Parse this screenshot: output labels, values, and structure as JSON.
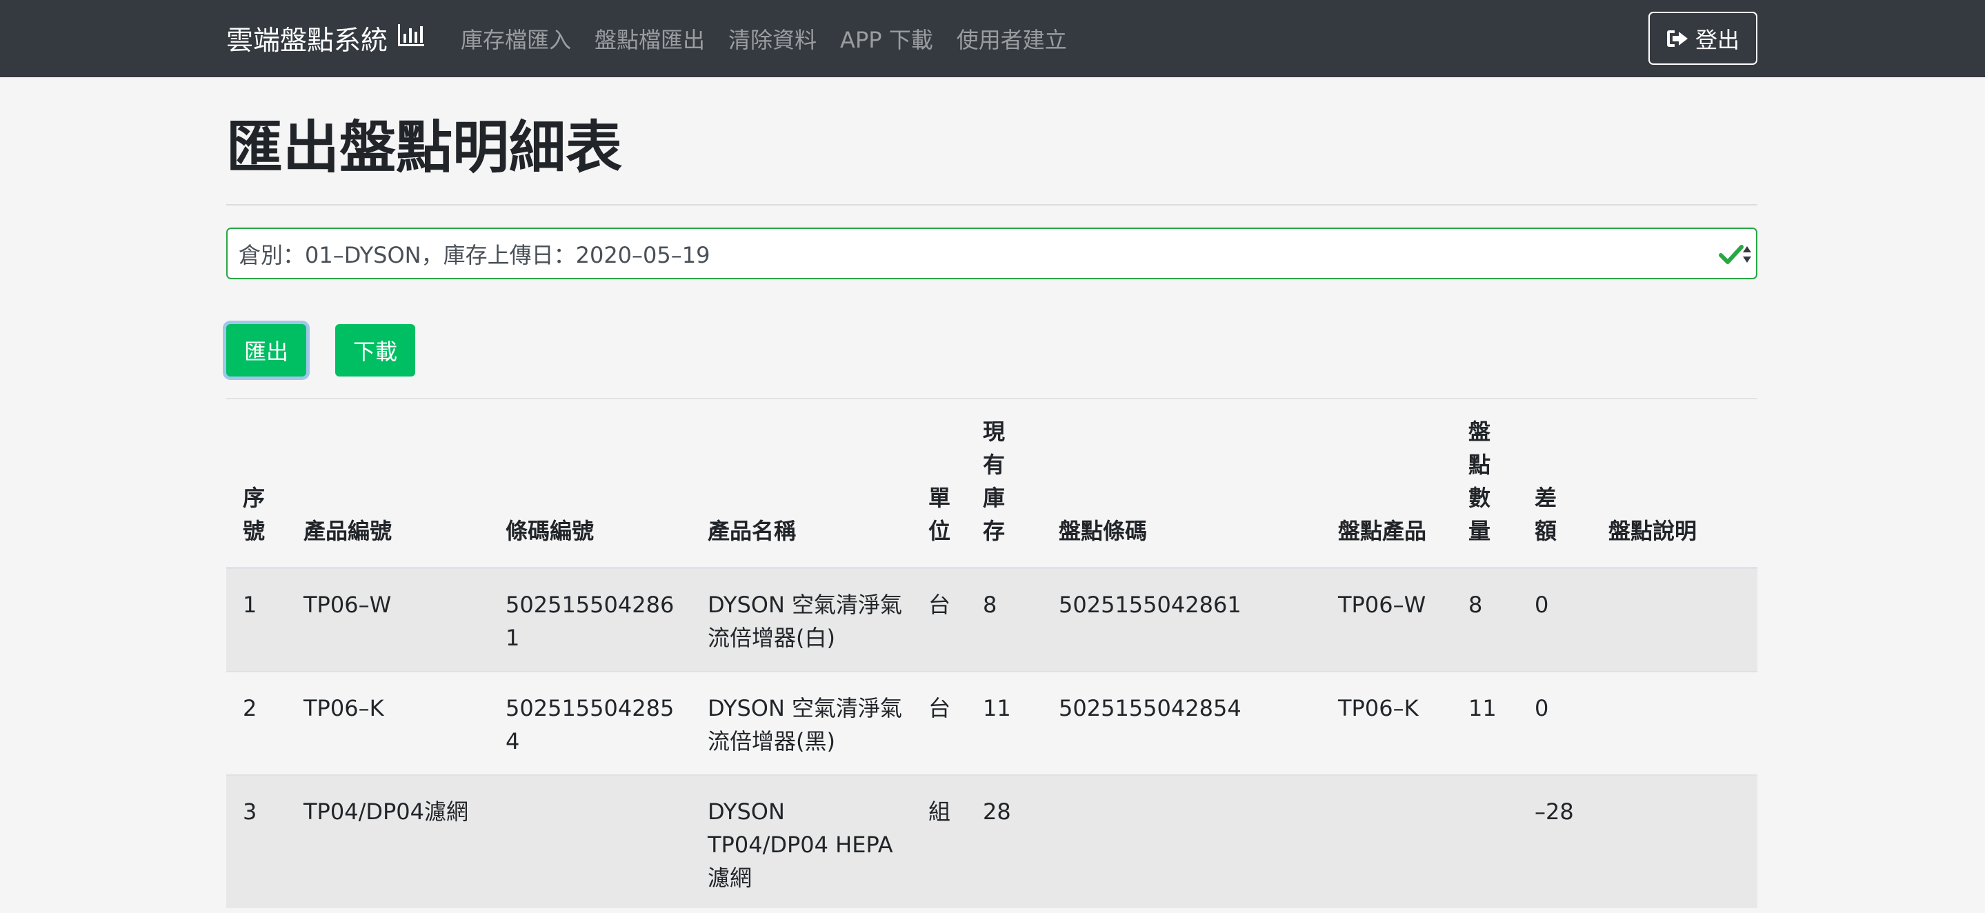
{
  "navbar": {
    "brand": "雲端盤點系統",
    "brand_icon": "bar-chart-icon",
    "links": [
      "庫存檔匯入",
      "盤點檔匯出",
      "清除資料",
      "APP 下載",
      "使用者建立"
    ],
    "logout_label": "登出",
    "logout_icon": "sign-out-icon"
  },
  "page": {
    "title": "匯出盤點明細表"
  },
  "warehouse_select": {
    "selected": "倉別：01–DYSON，庫存上傳日：2020–05–19",
    "valid_icon": "check-icon"
  },
  "actions": {
    "export_label": "匯出",
    "download_label": "下載"
  },
  "table": {
    "headers": [
      [
        "序",
        "號"
      ],
      [
        "產品編號"
      ],
      [
        "條碼編號"
      ],
      [
        "產品名稱"
      ],
      [
        "單",
        "位"
      ],
      [
        "現",
        "有",
        "庫",
        "存"
      ],
      [
        "盤點條碼"
      ],
      [
        "盤點產品"
      ],
      [
        "盤",
        "點",
        "數",
        "量"
      ],
      [
        "差",
        "額"
      ],
      [
        "盤點說明"
      ]
    ],
    "rows": [
      {
        "seq": "1",
        "product_code": "TP06–W",
        "barcode": "5025155042861",
        "product_name": "DYSON 空氣清淨氣流倍增器(白)",
        "unit": "台",
        "stock": "8",
        "count_barcode": "5025155042861",
        "count_product": "TP06–W",
        "count_qty": "8",
        "diff": "0",
        "note": ""
      },
      {
        "seq": "2",
        "product_code": "TP06–K",
        "barcode": "5025155042854",
        "product_name": "DYSON 空氣清淨氣流倍增器(黑)",
        "unit": "台",
        "stock": "11",
        "count_barcode": "5025155042854",
        "count_product": "TP06–K",
        "count_qty": "11",
        "diff": "0",
        "note": ""
      },
      {
        "seq": "3",
        "product_code": "TP04/DP04濾網",
        "barcode": "",
        "product_name": "DYSON TP04/DP04 HEPA濾網",
        "unit": "組",
        "stock": "28",
        "count_barcode": "",
        "count_product": "",
        "count_qty": "",
        "diff": "–28",
        "note": ""
      }
    ]
  },
  "colors": {
    "navbar_bg": "#343a40",
    "success_green": "#00bf63",
    "valid_border": "#28a745",
    "page_bg": "#f5f5f5"
  }
}
